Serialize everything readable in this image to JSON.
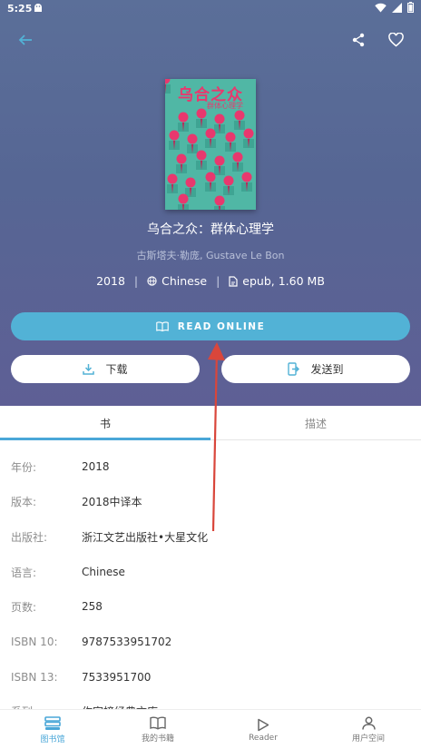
{
  "status_bar": {
    "time": "5:25"
  },
  "book": {
    "title": "乌合之众：群体心理学",
    "author": "古斯塔夫·勒庞, Gustave Le Bon",
    "cover_title": "乌合之众",
    "cover_subtitle": "群体心理学",
    "year": "2018",
    "language": "Chinese",
    "format": "epub, 1.60 MB"
  },
  "actions": {
    "read_online": "READ ONLINE",
    "download": "下载",
    "send_to": "发送到"
  },
  "tabs": [
    {
      "label": "书"
    },
    {
      "label": "描述"
    }
  ],
  "details": [
    {
      "key": "年份:",
      "value": "2018"
    },
    {
      "key": "版本:",
      "value": "2018中译本"
    },
    {
      "key": "出版社:",
      "value": "浙江文艺出版社•大星文化"
    },
    {
      "key": "语言:",
      "value": "Chinese"
    },
    {
      "key": "页数:",
      "value": "258"
    },
    {
      "key": "ISBN 10:",
      "value": "9787533951702"
    },
    {
      "key": "ISBN 13:",
      "value": "7533951700"
    },
    {
      "key": "系列:",
      "value": "作家榜经典文库"
    }
  ],
  "bottom_nav": [
    {
      "label": "图书馆"
    },
    {
      "label": "我的书籍"
    },
    {
      "label": "Reader"
    },
    {
      "label": "用户空间"
    }
  ],
  "colors": {
    "hero_bg": "#5a6997",
    "accent": "#52b2d6",
    "active_tab": "#4aa7d8",
    "annotation_arrow": "#d9463b"
  }
}
